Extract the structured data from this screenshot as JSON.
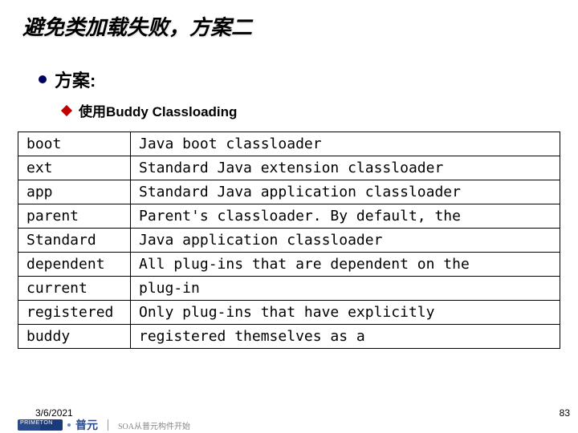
{
  "title": "避免类加载失败，方案二",
  "bullet": "方案:",
  "sub_bullet": "使用Buddy Classloading",
  "rows": [
    {
      "k": "boot",
      "v": "Java boot classloader"
    },
    {
      "k": "ext",
      "v": "Standard Java extension classloader"
    },
    {
      "k": "app",
      "v": "Standard Java application classloader"
    },
    {
      "k": "parent",
      "v": "Parent's classloader. By default, the"
    },
    {
      "k": "Standard",
      "v": "Java application classloader"
    },
    {
      "k": "dependent",
      "v": "All plug-ins that are dependent on the"
    },
    {
      "k": "current",
      "v": "plug-in"
    },
    {
      "k": "registered",
      "v": "Only plug-ins that have explicitly"
    },
    {
      "k": "buddy",
      "v": "registered themselves as a"
    }
  ],
  "footer": {
    "date": "3/6/2021",
    "page": "83",
    "brand_cn": "普元",
    "tagline": "SOA从普元构件开始"
  }
}
